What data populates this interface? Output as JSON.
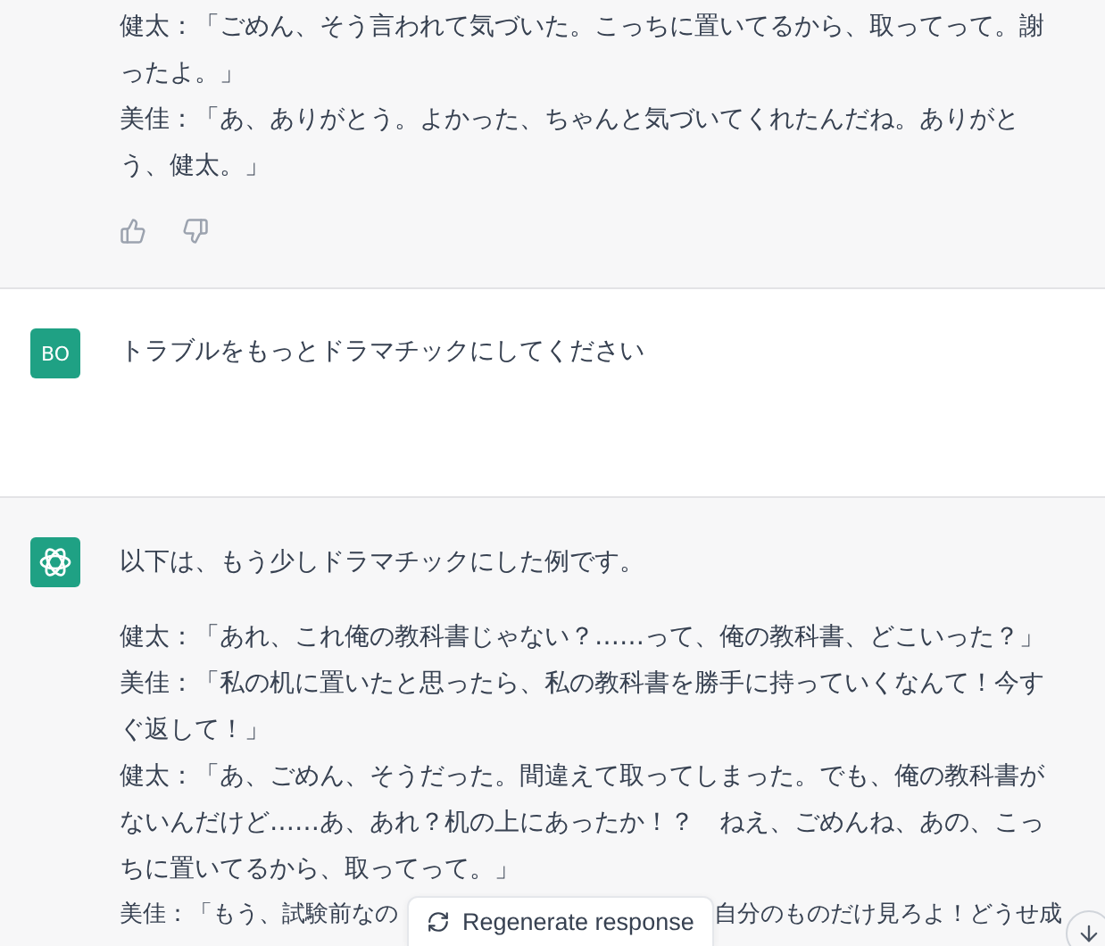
{
  "messages": [
    {
      "kind": "assistant",
      "show_avatar": false,
      "paragraphs": [
        "健太：「ごめん、そう言われて気づいた。こっちに置いてるから、取ってって。謝ったよ。」",
        "美佳：「あ、ありがとう。よかった、ちゃんと気づいてくれたんだね。ありがとう、健太。」"
      ],
      "feedback": true
    },
    {
      "kind": "user",
      "avatar": "BO",
      "paragraphs": [
        "トラブルをもっとドラマチックにしてください"
      ]
    },
    {
      "kind": "assistant",
      "show_avatar": true,
      "intro": "以下は、もう少しドラマチックにした例です。",
      "paragraphs": [
        "健太：「あれ、これ俺の教科書じゃない？……って、俺の教科書、どこいった？」",
        "美佳：「私の机に置いたと思ったら、私の教科書を勝手に持っていくなんて！今すぐ返して！」",
        "健太：「あ、ごめん、そうだった。間違えて取ってしまった。でも、俺の教科書がないんだけど……あ、あれ？机の上にあったか！？　ねえ、ごめんね、あの、こっちに置いてるから、取ってって。」"
      ],
      "partial_line": {
        "before": "美佳：「もう、試験前なの",
        "after": "自分のものだけ見ろよ！どうせ成"
      }
    }
  ],
  "regenerate_button": "Regenerate response"
}
